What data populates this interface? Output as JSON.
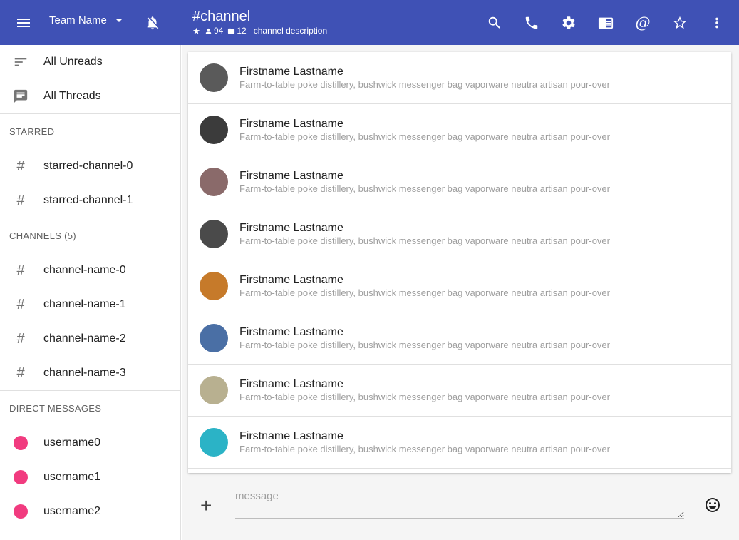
{
  "topbar": {
    "team_name": "Team Name",
    "channel_title": "#channel",
    "members": "94",
    "files": "12",
    "description": "channel description",
    "at_symbol": "@"
  },
  "sidebar": {
    "nav": [
      {
        "label": "All Unreads",
        "icon": "sort-icon"
      },
      {
        "label": "All Threads",
        "icon": "comment-icon"
      }
    ],
    "starred_header": "STARRED",
    "starred": [
      "starred-channel-0",
      "starred-channel-1"
    ],
    "channels_header": "CHANNELS (5)",
    "channels": [
      "channel-name-0",
      "channel-name-1",
      "channel-name-2",
      "channel-name-3"
    ],
    "dm_header": "DIRECT MESSAGES",
    "dms": [
      "username0",
      "username1",
      "username2"
    ]
  },
  "messages": [
    {
      "name": "Firstname Lastname",
      "text": "Farm-to-table poke distillery, bushwick messenger bag vaporware neutra artisan pour-over",
      "avatar_color": "#5a5a5a"
    },
    {
      "name": "Firstname Lastname",
      "text": "Farm-to-table poke distillery, bushwick messenger bag vaporware neutra artisan pour-over",
      "avatar_color": "#3b3b3b"
    },
    {
      "name": "Firstname Lastname",
      "text": "Farm-to-table poke distillery, bushwick messenger bag vaporware neutra artisan pour-over",
      "avatar_color": "#8a6a6a"
    },
    {
      "name": "Firstname Lastname",
      "text": "Farm-to-table poke distillery, bushwick messenger bag vaporware neutra artisan pour-over",
      "avatar_color": "#4a4a4a"
    },
    {
      "name": "Firstname Lastname",
      "text": "Farm-to-table poke distillery, bushwick messenger bag vaporware neutra artisan pour-over",
      "avatar_color": "#c67a2a"
    },
    {
      "name": "Firstname Lastname",
      "text": "Farm-to-table poke distillery, bushwick messenger bag vaporware neutra artisan pour-over",
      "avatar_color": "#4a6fa5"
    },
    {
      "name": "Firstname Lastname",
      "text": "Farm-to-table poke distillery, bushwick messenger bag vaporware neutra artisan pour-over",
      "avatar_color": "#b8b090"
    },
    {
      "name": "Firstname Lastname",
      "text": "Farm-to-table poke distillery, bushwick messenger bag vaporware neutra artisan pour-over",
      "avatar_color": "#2bb3c6"
    }
  ],
  "composer": {
    "placeholder": "message",
    "add_label": "+"
  },
  "colors": {
    "appbar": "#3f51b5",
    "presence": "#f13b7f"
  }
}
